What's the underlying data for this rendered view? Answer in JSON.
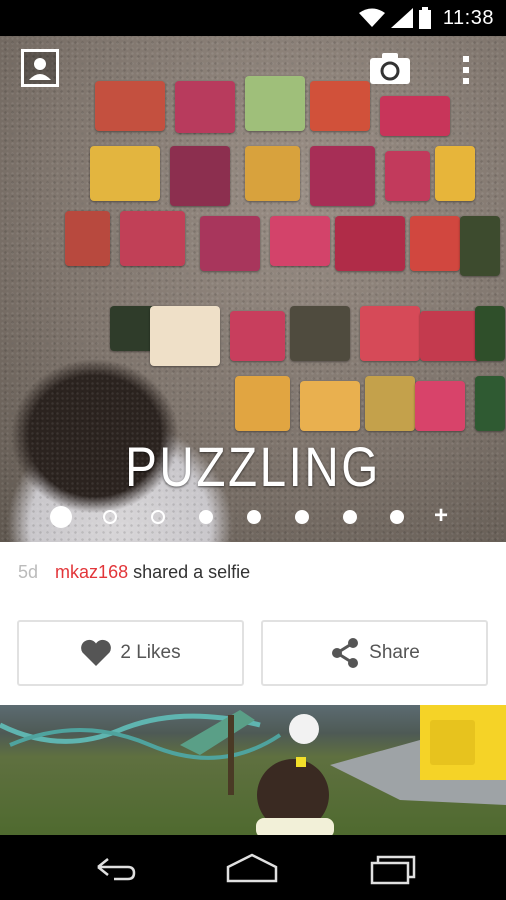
{
  "status_bar": {
    "time": "11:38",
    "icons": [
      "wifi-icon",
      "signal-icon",
      "battery-icon"
    ]
  },
  "hero": {
    "title": "PUZZLING",
    "page_count": 8,
    "active_page": 1,
    "add_symbol": "+"
  },
  "post": {
    "age": "5d",
    "username": "mkaz168",
    "action_text": "shared a selfie",
    "likes_label": "2 Likes",
    "share_label": "Share"
  },
  "colors": {
    "username": "#e2363a",
    "status_bar": "#000000",
    "nav_bar": "#000000",
    "button_border": "#e1e1e1"
  },
  "nav": {
    "icons": [
      "back-icon",
      "home-icon",
      "recent-apps-icon"
    ]
  }
}
